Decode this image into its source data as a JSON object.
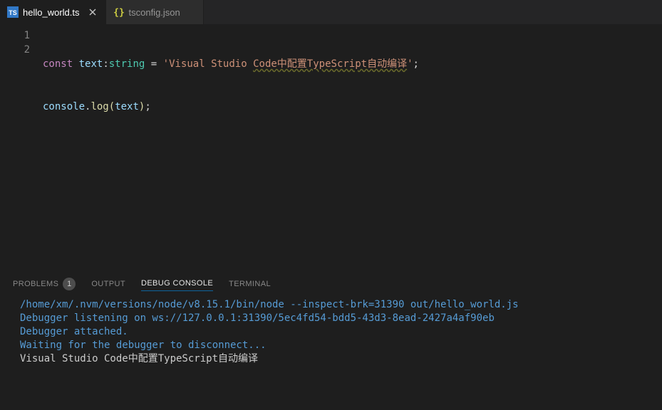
{
  "tabs": [
    {
      "label": "hello_world.ts",
      "icon": "TS",
      "active": true,
      "dirty_close": true
    },
    {
      "label": "tsconfig.json",
      "icon": "{}",
      "active": false,
      "dirty_close": false
    }
  ],
  "code": {
    "line_numbers": [
      "1",
      "2"
    ],
    "line1": {
      "k_const": "const",
      "var": "text",
      "colon": ":",
      "type": "string",
      "eq": "=",
      "str_q1": "'",
      "str_a": "Visual Studio ",
      "str_b": "Code中配置TypeScript自动编译",
      "str_q2": "'",
      "semi": ";"
    },
    "line2": {
      "obj": "console",
      "dot": ".",
      "fn": "log",
      "lp": "(",
      "arg": "text",
      "rp": ")",
      "semi": ";"
    }
  },
  "panel": {
    "tabs": {
      "problems": "PROBLEMS",
      "problems_count": "1",
      "output": "OUTPUT",
      "debug_console": "DEBUG CONSOLE",
      "terminal": "TERMINAL"
    },
    "lines": {
      "cmd": "/home/xm/.nvm/versions/node/v8.15.1/bin/node --inspect-brk=31390 out/hello_world.js",
      "listen": "Debugger listening on ws://127.0.0.1:31390/5ec4fd54-bdd5-43d3-8ead-2427a4af90eb",
      "attached": "Debugger attached.",
      "waiting": "Waiting for the debugger to disconnect...",
      "output": "Visual Studio Code中配置TypeScript自动编译"
    }
  }
}
